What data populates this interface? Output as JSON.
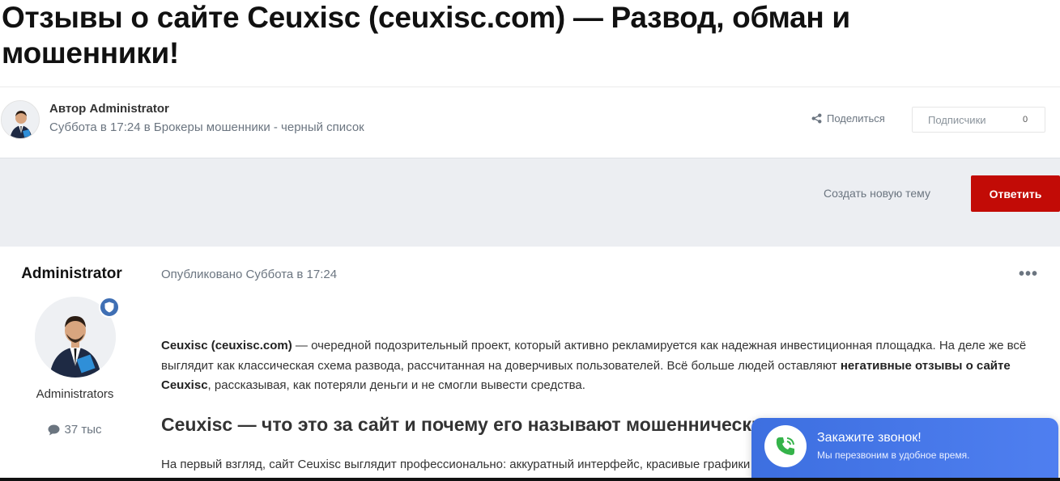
{
  "topic": {
    "title": "Отзывы о сайте Ceuxisc (ceuxisc.com) — Развод, обман и мошенники!"
  },
  "meta": {
    "author_prefix": "Автор",
    "author_name": "Administrator",
    "date_prefix": "Суббота в 17:24 в",
    "category": "Брокеры мошенники - черный список",
    "share_label": "Поделиться",
    "followers_label": "Подписчики",
    "followers_count": "0",
    "share_icon": "share-icon"
  },
  "actions": {
    "new_topic_label": "Создать новую тему",
    "reply_label": "Ответить",
    "reply_color": "#c20b06"
  },
  "post": {
    "author_name": "Administrator",
    "group": "Administrators",
    "post_count": "37 тыс",
    "published": "Опубликовано Суббота в 17:24",
    "menu_label": "•••",
    "p1_bold1": "Ceuxisc (ceuxisc.com)",
    "p1_text1": " — очередной подозрительный проект, который активно рекламируется как надежная инвестиционная площадка. На деле же всё выглядит как классическая схема развода, рассчитанная на доверчивых пользователей. Всё больше людей оставляют ",
    "p1_bold2": "негативные отзывы о сайте Ceuxisc",
    "p1_text2": ", рассказывая, как потеряли деньги и не смогли вывести средства.",
    "h2": "Ceuxisc — что это за сайт и почему его называют мошенническим",
    "p2": "На первый взгляд, сайт Ceuxisc выглядит профессионально: аккуратный интерфейс, красивые графики и обещания высокой доходности."
  },
  "callback": {
    "title": "Закажите звонок!",
    "subtitle": "Мы перезвоним в удобное время.",
    "accent": "#3d6fe0",
    "icon": "phone-icon"
  }
}
